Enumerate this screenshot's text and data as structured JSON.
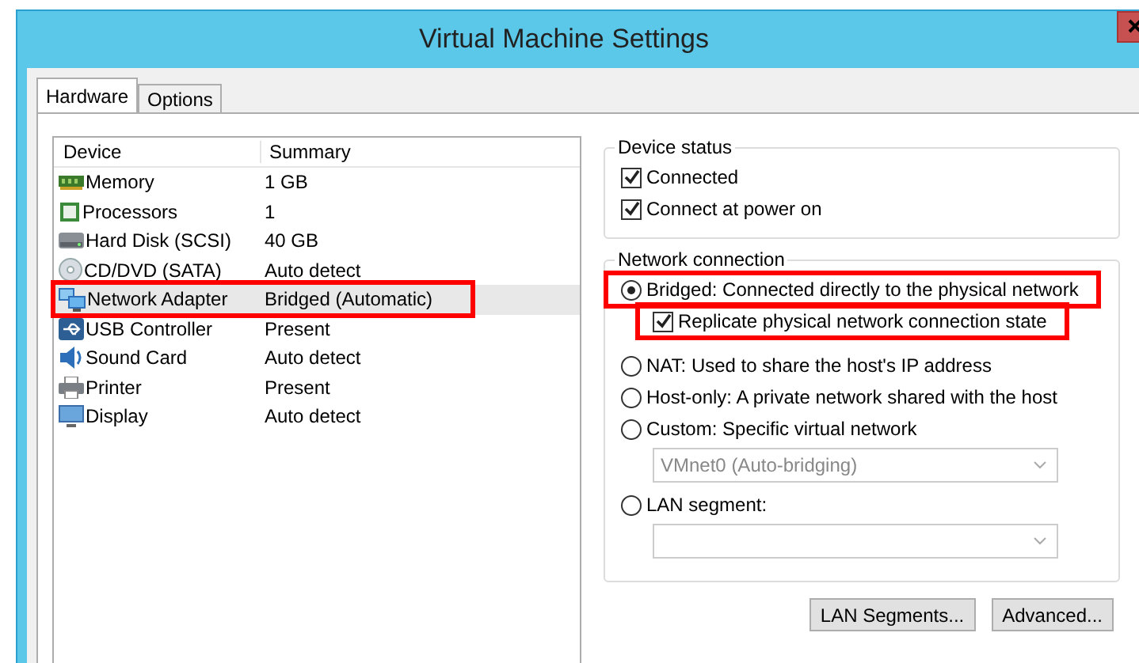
{
  "window": {
    "title": "Virtual Machine Settings"
  },
  "tabs": [
    {
      "label": "Hardware",
      "selected": true
    },
    {
      "label": "Options",
      "selected": false
    }
  ],
  "device_list": {
    "columns": [
      "Device",
      "Summary"
    ],
    "rows": [
      {
        "kind": "memory",
        "device": "Memory",
        "summary": "1 GB",
        "selected": false,
        "highlighted": false
      },
      {
        "kind": "processor",
        "device": "Processors",
        "summary": "1",
        "selected": false,
        "highlighted": false
      },
      {
        "kind": "disk",
        "device": "Hard Disk (SCSI)",
        "summary": "40 GB",
        "selected": false,
        "highlighted": false
      },
      {
        "kind": "cd",
        "device": "CD/DVD (SATA)",
        "summary": "Auto detect",
        "selected": false,
        "highlighted": false
      },
      {
        "kind": "network",
        "device": "Network Adapter",
        "summary": "Bridged (Automatic)",
        "selected": true,
        "highlighted": true
      },
      {
        "kind": "usb",
        "device": "USB Controller",
        "summary": "Present",
        "selected": false,
        "highlighted": false
      },
      {
        "kind": "sound",
        "device": "Sound Card",
        "summary": "Auto detect",
        "selected": false,
        "highlighted": false
      },
      {
        "kind": "printer",
        "device": "Printer",
        "summary": "Present",
        "selected": false,
        "highlighted": false
      },
      {
        "kind": "display",
        "device": "Display",
        "summary": "Auto detect",
        "selected": false,
        "highlighted": false
      }
    ]
  },
  "device_status": {
    "title": "Device status",
    "options": [
      {
        "label": "Connected",
        "checked": true
      },
      {
        "label": "Connect at power on",
        "checked": true
      }
    ]
  },
  "network_connection": {
    "title": "Network connection",
    "items": [
      {
        "kind": "radio",
        "label": "Bridged: Connected directly to the physical network",
        "selected": true,
        "highlighted": true
      },
      {
        "kind": "checkbox",
        "label": "Replicate physical network connection state",
        "checked": true,
        "highlighted": true
      },
      {
        "kind": "radio",
        "label": "NAT: Used to share the host's IP address",
        "selected": false,
        "highlighted": false
      },
      {
        "kind": "radio",
        "label": "Host-only: A private network shared with the host",
        "selected": false,
        "highlighted": false
      },
      {
        "kind": "radio",
        "label": "Custom: Specific virtual network",
        "selected": false,
        "highlighted": false
      },
      {
        "kind": "dropdown",
        "value": "VMnet0 (Auto-bridging)",
        "disabled": true
      },
      {
        "kind": "radio",
        "label": "LAN segment:",
        "selected": false,
        "highlighted": false
      },
      {
        "kind": "dropdown",
        "disabled": true
      }
    ]
  },
  "buttons": [
    "LAN Segments...",
    "Advanced..."
  ]
}
